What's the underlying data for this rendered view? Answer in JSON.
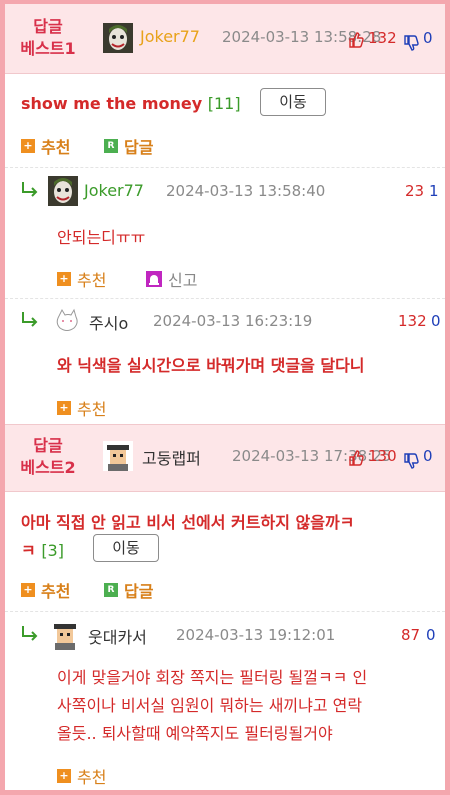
{
  "best1": {
    "label_line1": "답글",
    "label_line2": "베스트1",
    "nick": "Joker77",
    "time": "2024-03-13 13:58:28",
    "up": "132",
    "down": "0",
    "title": "show me the money",
    "count": "[11]",
    "move_label": "이동",
    "recommend_label": "추천",
    "reply_label": "답글"
  },
  "reply1": {
    "nick": "Joker77",
    "time": "2024-03-13 13:58:40",
    "up": "23",
    "down": "1",
    "text": "안되는디ㅠㅠ",
    "recommend_label": "추천",
    "report_label": "신고"
  },
  "reply2": {
    "nick": "주시o",
    "time": "2024-03-13 16:23:19",
    "up": "132",
    "down": "0",
    "text": "와 닉색을 실시간으로 바꿔가며 댓글을 달다니",
    "recommend_label": "추천"
  },
  "best2": {
    "label_line1": "답글",
    "label_line2": "베스트2",
    "nick": "고둥랩퍼",
    "time": "2024-03-13 17:38:25",
    "up": "130",
    "down": "0",
    "title_line1": "아마 직접 안 읽고 비서 선에서 커트하지 않을까ㅋ",
    "title_line2": "ㅋ",
    "count": "[3]",
    "move_label": "이동",
    "recommend_label": "추천",
    "reply_label": "답글"
  },
  "reply3": {
    "nick": "웃대카서",
    "time": "2024-03-13 19:12:01",
    "up": "87",
    "down": "0",
    "text_line1": "이게 맞을거야 회장 쪽지는 필터링 될껄ㅋㅋ 인",
    "text_line2": "사쪽이나 비서실 임원이 뭐하는 새끼냐고 연락",
    "text_line3": "올듯.. 퇴사할때 예약쪽지도 필터링될거야",
    "recommend_label": "추천"
  },
  "colors": {
    "frame": "#f4a7ae",
    "best_bg": "#fde6e8",
    "red": "#d42a2a",
    "orange": "#d8801a",
    "blue": "#1f3fb8"
  }
}
